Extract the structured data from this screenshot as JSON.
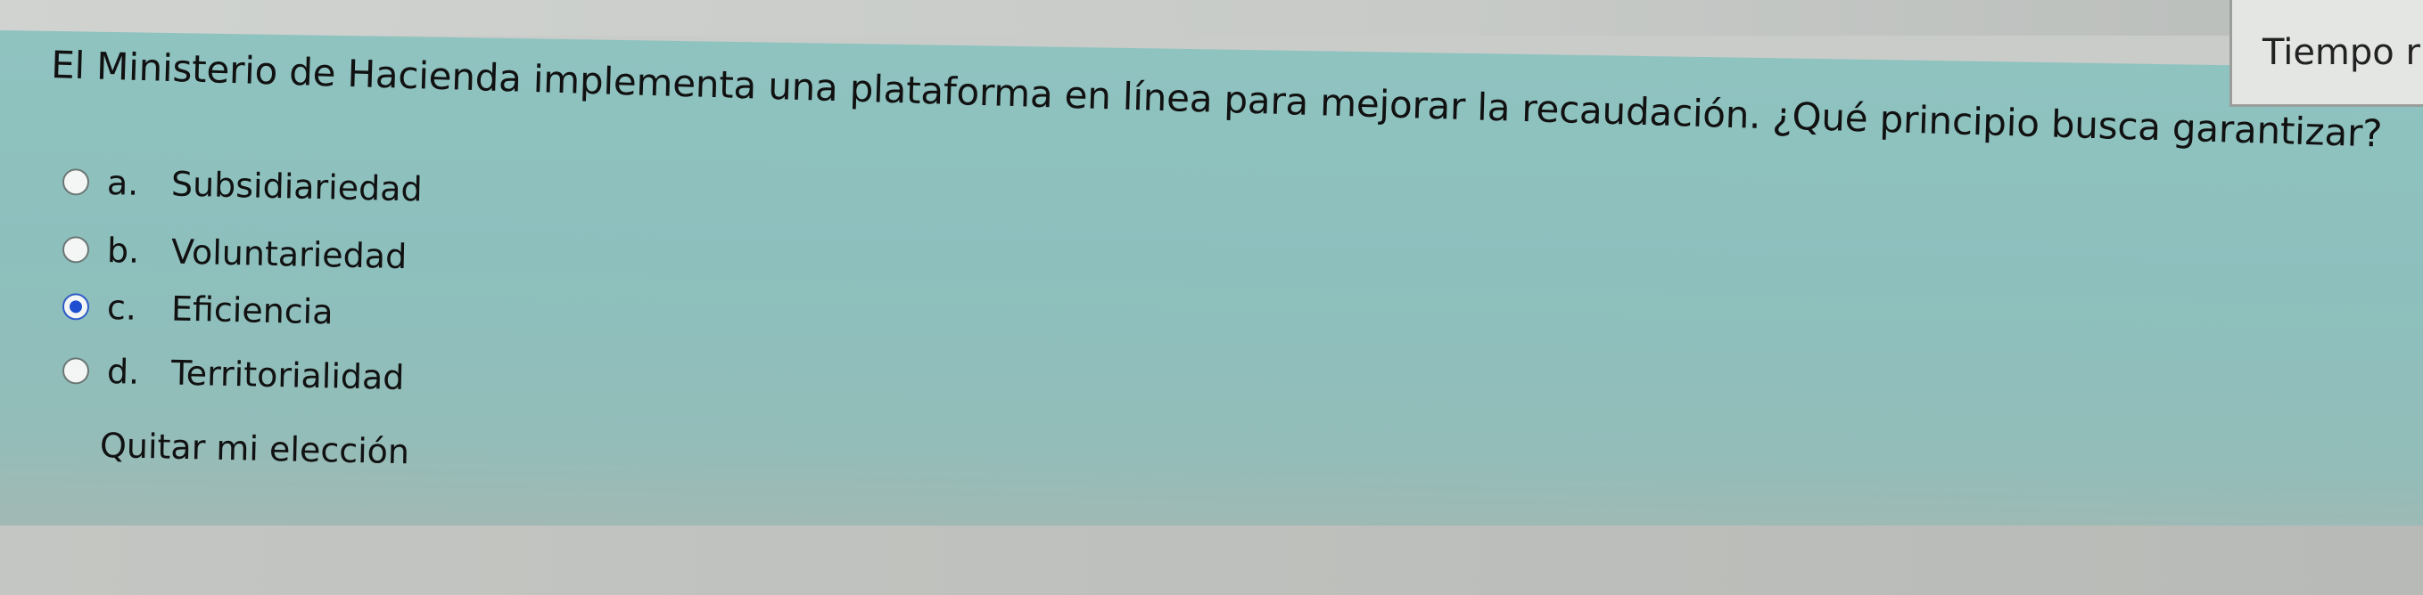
{
  "timer": {
    "label": "Tiempo r"
  },
  "question": {
    "text": "El Ministerio de Hacienda implementa una plataforma en línea para mejorar la recaudación. ¿Qué principio busca garantizar?"
  },
  "options": [
    {
      "letter": "a.",
      "label": "Subsidiariedad",
      "selected": false
    },
    {
      "letter": "b.",
      "label": "Voluntariedad",
      "selected": false
    },
    {
      "letter": "c.",
      "label": "Eficiencia",
      "selected": true
    },
    {
      "letter": "d.",
      "label": "Territorialidad",
      "selected": false
    }
  ],
  "actions": {
    "clear_choice": "Quitar mi elección"
  },
  "colors": {
    "card_background": "#8fc3c0",
    "radio_selected": "#1f4fd0"
  }
}
